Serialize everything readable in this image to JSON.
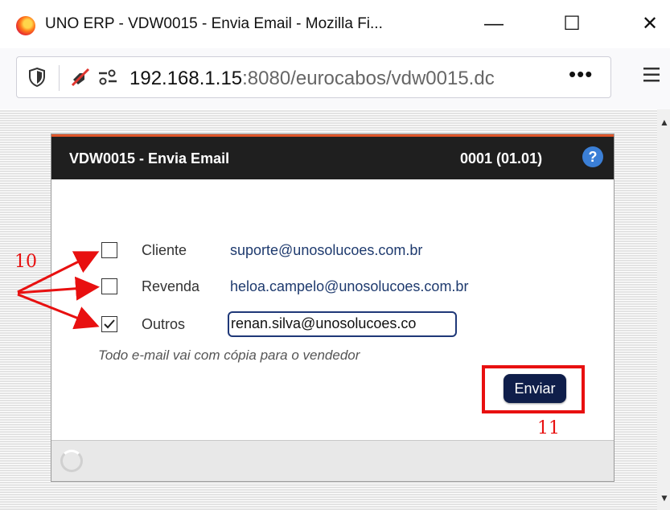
{
  "window": {
    "title": "UNO ERP - VDW0015 - Envia Email - Mozilla Fi...",
    "minimize_glyph": "—",
    "maximize_glyph": "☐",
    "close_glyph": "✕",
    "icons": [
      "firefox-logo-icon",
      "minimize-icon",
      "maximize-icon",
      "close-icon"
    ]
  },
  "urlbar": {
    "host": "192.168.1.15",
    "rest": ":8080/eurocabos/vdw0015.dc",
    "more": "•••",
    "icons": [
      "shield-icon",
      "blocked-permission-icon",
      "permissions-icon",
      "hamburger-menu-icon"
    ]
  },
  "dialog": {
    "title": "VDW0015 - Envia Email",
    "code": "0001 (01.01)",
    "help": "?",
    "rows": [
      {
        "label": "Cliente",
        "email": "suporte@unosolucoes.com.br",
        "checked": false
      },
      {
        "label": "Revenda",
        "email": "heloa.campelo@unosolucoes.com.br",
        "checked": false
      },
      {
        "label": "Outros",
        "email": "renan.silva@unosolucoes.co",
        "checked": true
      }
    ],
    "note": "Todo e-mail vai com cópia para o vendedor",
    "send_button": "Enviar"
  },
  "annotations": {
    "label_10": "10",
    "label_11": "11",
    "color": "#e81010"
  },
  "colors": {
    "header_bg": "#1f1f1f",
    "header_accent": "#e0562a",
    "button_bg": "#0f1e4a",
    "help_blue": "#3b7fd6"
  }
}
